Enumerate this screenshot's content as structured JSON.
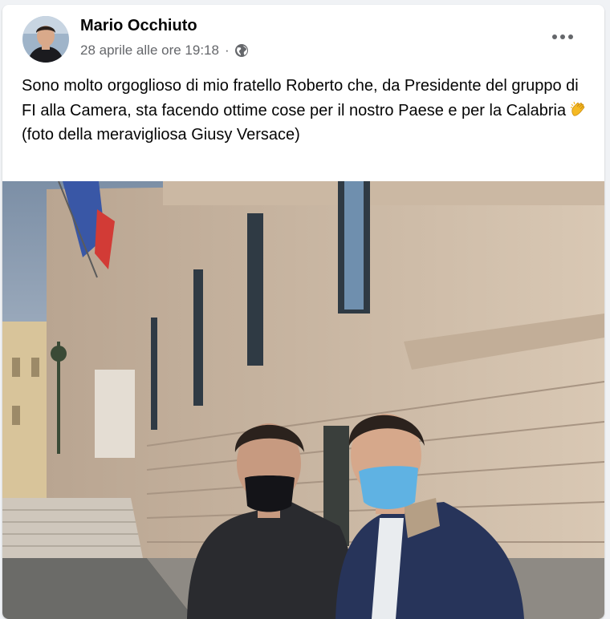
{
  "post": {
    "author": "Mario Occhiuto",
    "timestamp": "28 aprile alle ore 19:18",
    "separator": "·",
    "audience_icon": "globe-icon",
    "more_icon": "more-horizontal-icon",
    "text_lines": [
      "Sono molto orgoglioso di mio fratello Roberto che, da Presidente del gruppo di FI alla Camera, sta facendo ottime cose per il nostro Paese e per la Calabria",
      "(foto della meravigliosa Giusy Versace)"
    ],
    "emoji": "clapping-hands-emoji",
    "photo_subject": "two-men-with-face-masks-in-front-of-palazzo"
  },
  "colors": {
    "background": "#f0f2f5",
    "card": "#ffffff",
    "text": "#050505",
    "secondary_text": "#65676b"
  }
}
